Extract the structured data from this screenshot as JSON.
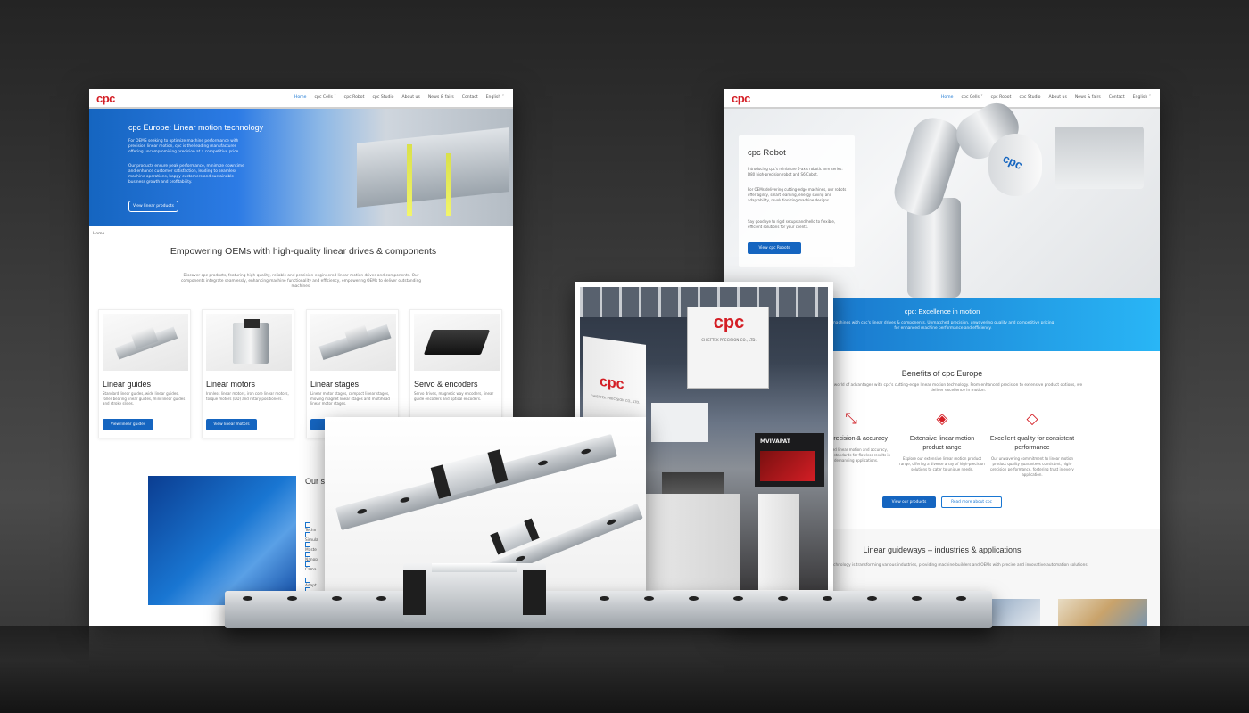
{
  "left_site": {
    "logo": "cpc",
    "nav": [
      "Home",
      "cpc Cells ˅",
      "cpc Robot",
      "cpc Studio",
      "About us",
      "News & fairs",
      "Contact",
      "English ˅"
    ],
    "hero": {
      "title": "cpc Europe: Linear motion technology",
      "p1": "For OEMS seeking to optimize machine performance with precision linear motion, cpc is the leading manufacturer offering uncompromising precision at a competitive price.",
      "p2": "Our products ensure peak performance, minimize downtime and enhance customer satisfaction, leading to seamless machine operations, happy customers and sustainable business growth and profitability.",
      "button": "View linear products"
    },
    "breadcrumb": "Home",
    "heading": "Empowering OEMs with high-quality linear drives & components",
    "intro": "Discover cpc products, featuring high-quality, reliable and precision-engineered linear motion drives and components. Our components integrate seamlessly, enhancing machine functionality and efficiency, empowering OEMs to deliver outstanding machines.",
    "cards": [
      {
        "title": "Linear guides",
        "text": "Standard linear guides, wide linear guides, roller bearing linear guides, mini linear guides and stroke slides.",
        "button": "View linear guides"
      },
      {
        "title": "Linear motors",
        "text": "Ironless linear motors, iron core linear motors, torque motors (DD) and rotary positioners.",
        "button": "View linear motors"
      },
      {
        "title": "Linear stages",
        "text": "Linear motor stages, compact linear stages, moving magnet linear stages and multihead linear motor stages.",
        "button": "View"
      },
      {
        "title": "Servo & encoders",
        "text": "Servo drives, magnetic way encoders, linear guide encoders and optical encoders.",
        "button": ""
      }
    ],
    "section2": {
      "heading": "Our s... need",
      "checks": [
        "Techn",
        "Simula",
        "Maste",
        "Nanop",
        "Cama",
        "Adapt",
        "Overa"
      ]
    }
  },
  "right_site": {
    "logo": "cpc",
    "nav": [
      "Home",
      "cpc Cells ˅",
      "cpc Robot",
      "cpc Studio",
      "About us",
      "News & fairs",
      "Contact",
      "English ˅"
    ],
    "hero": {
      "title": "cpc Robot",
      "p1": "Introducing cpc's miniature 6-axis robotic arm series: D80 high-precision robot and S6 Cobot.",
      "p2": "For OEMs delivering cutting-edge machines, our robots offer agility, smart learning, energy saving and adaptability, revolutionizing machine designs.",
      "p3": "Say goodbye to rigid setups and hello to flexible, efficient solutions for your clients.",
      "button": "View cpc Robots",
      "robot_label": "cpc"
    },
    "band": {
      "title": "cpc: Excellence in motion",
      "text": "machines with cpc's linear drives & components. Unmatched precision, unwavering quality and competitive pricing for enhanced machine performance and efficiency."
    },
    "benefits": {
      "heading": "Benefits of cpc Europe",
      "intro": "world of advantages with cpc's cutting-edge linear motion technology. From enhanced precision to extensive product options, we deliver excellence in motion.",
      "items": [
        {
          "icon": "arrows-inward-icon",
          "title": "mate precision & accuracy",
          "text": "unparalleled linear motion and accuracy, setting new standards for flawless results in most demanding applications."
        },
        {
          "icon": "layers-icon",
          "title": "Extensive linear motion product range",
          "text": "Explore our extensive linear motion product range, offering a diverse array of high-precision solutions to cater to unique needs."
        },
        {
          "icon": "diamond-icon",
          "title": "Excellent quality for consistent performance",
          "text": "Our unwavering commitment to linear motion product quality guarantees consistent, high-precision performance, fostering trust in every application."
        }
      ],
      "btn_primary": "View our products",
      "btn_secondary": "Read more about cpc"
    },
    "guideways": {
      "heading": "Linear guideways – industries & applications",
      "text": "ar technology is transforming various industries, providing machine builders and OEMs with precise and innovative automation solutions."
    }
  },
  "booth_photo": {
    "sign_top": "cpc",
    "sign_sub": "CHIEFTEK PRECISION CO., LTD.",
    "sign_side": "cpc",
    "sign_side_sub": "CHIEFTEK PRECISION CO., LTD.",
    "banner": "MVIVAPAT"
  },
  "colors": {
    "brand_red": "#d41e25",
    "brand_blue": "#1565c0",
    "accent_cyan": "#29b6f6"
  }
}
